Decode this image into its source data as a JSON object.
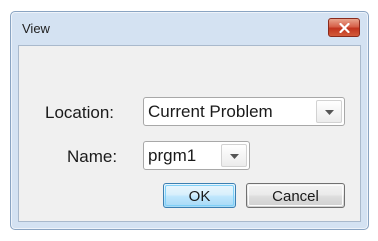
{
  "window": {
    "title": "View",
    "close_icon": "close-x-icon"
  },
  "form": {
    "location_label": "Location:",
    "location_value": "Current Problem",
    "name_label": "Name:",
    "name_value": "prgm1",
    "dropdown_icon": "chevron-down-icon"
  },
  "buttons": {
    "ok_label": "OK",
    "cancel_label": "Cancel"
  },
  "colors": {
    "frame": "#d4e2f2",
    "close_button": "#c2341e",
    "ok_button": "#bee6fd"
  }
}
